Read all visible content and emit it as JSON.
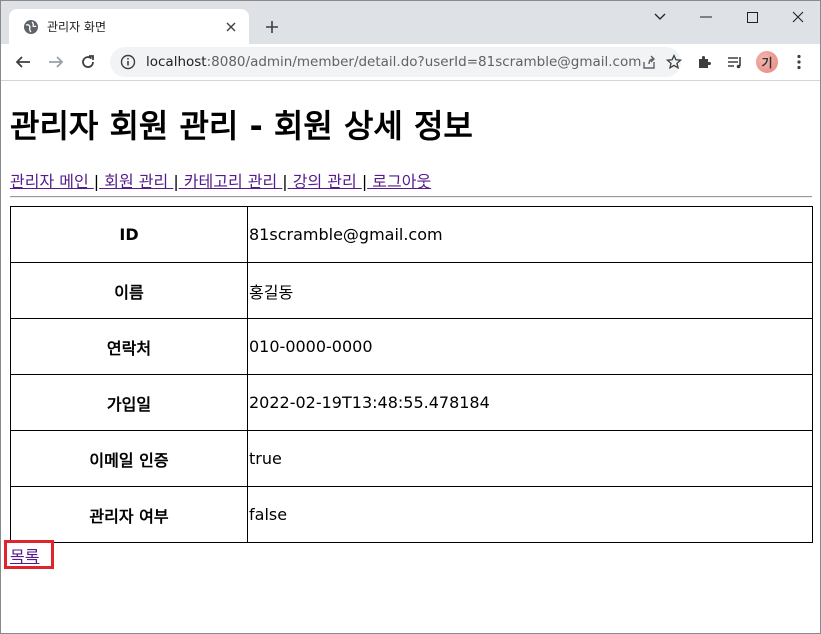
{
  "browser": {
    "tab_title": "관리자 화면",
    "url_host": "localhost",
    "url_rest": ":8080/admin/member/detail.do?userId=81scramble@gmail.com",
    "profile_initial": "기"
  },
  "page": {
    "title": "관리자 회원 관리 - 회원 상세 정보",
    "nav": [
      {
        "label": "관리자 메인 "
      },
      {
        "label": " 회원 관리 "
      },
      {
        "label": " 카테고리 관리 "
      },
      {
        "label": " 강의 관리 "
      },
      {
        "label": " 로그아웃"
      }
    ],
    "nav_separator": "|",
    "rows": [
      {
        "label": "ID",
        "value": "81scramble@gmail.com"
      },
      {
        "label": "이름",
        "value": "홍길동"
      },
      {
        "label": "연락처",
        "value": "010-0000-0000"
      },
      {
        "label": "가입일",
        "value": "2022-02-19T13:48:55.478184"
      },
      {
        "label": "이메일 인증",
        "value": "true"
      },
      {
        "label": "관리자 여부",
        "value": "false"
      }
    ],
    "list_link": "목록"
  },
  "colors": {
    "link_visited": "#551a8b",
    "highlight_box": "#e0242c"
  }
}
